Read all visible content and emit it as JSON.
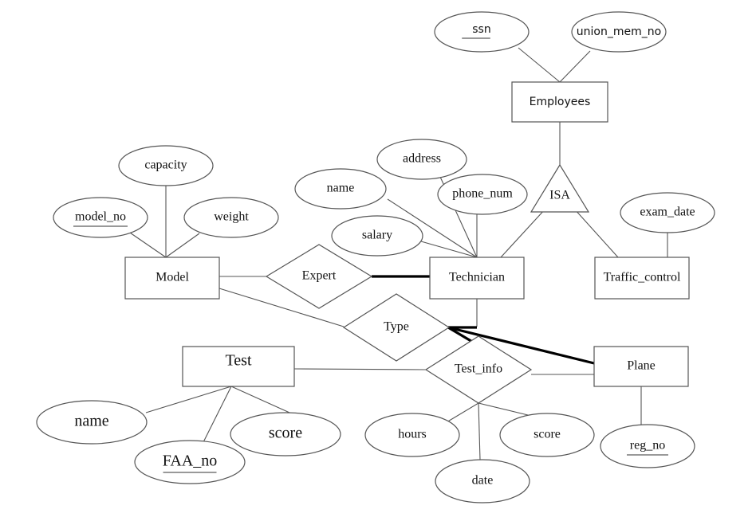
{
  "entities": {
    "employees": "Employees",
    "technician": "Technician",
    "traffic_control": "Traffic_control",
    "model": "Model",
    "test": "Test",
    "plane": "Plane"
  },
  "relationships": {
    "expert": "Expert",
    "type": "Type",
    "test_info": "Test_info",
    "isa": "ISA"
  },
  "attributes": {
    "ssn": {
      "label": "ssn",
      "key": true
    },
    "union_mem_no": {
      "label": "union_mem_no",
      "key": false
    },
    "capacity": {
      "label": "capacity",
      "key": false
    },
    "model_no": {
      "label": "model_no",
      "key": true
    },
    "weight": {
      "label": "weight",
      "key": false
    },
    "address": {
      "label": "address",
      "key": false
    },
    "tech_name": {
      "label": "name",
      "key": false
    },
    "phone_num": {
      "label": "phone_num",
      "key": false
    },
    "salary": {
      "label": "salary",
      "key": false
    },
    "exam_date": {
      "label": "exam_date",
      "key": false
    },
    "test_name": {
      "label": "name",
      "key": false
    },
    "faa_no": {
      "label": "FAA_no",
      "key": true
    },
    "test_score": {
      "label": "score",
      "key": false
    },
    "hours": {
      "label": "hours",
      "key": false
    },
    "info_score": {
      "label": "score",
      "key": false
    },
    "date": {
      "label": "date",
      "key": false
    },
    "reg_no": {
      "label": "reg_no",
      "key": true
    }
  }
}
